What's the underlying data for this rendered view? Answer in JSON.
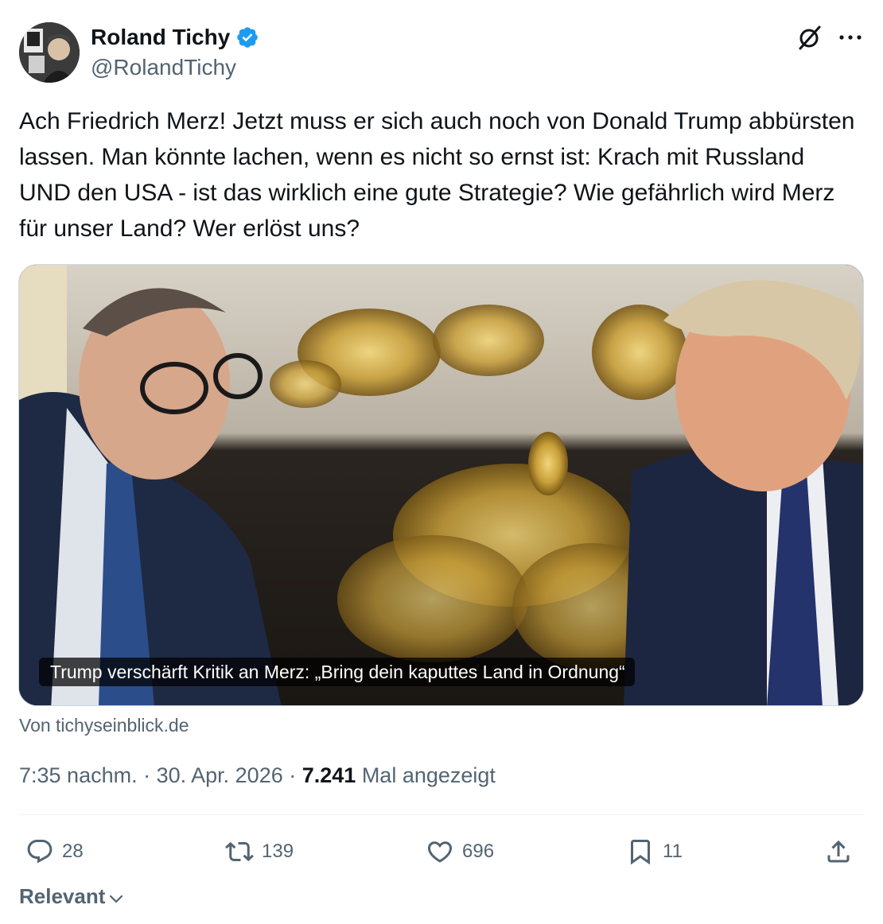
{
  "author": {
    "display_name": "Roland Tichy",
    "handle": "@RolandTichy",
    "verified": true,
    "verified_color": "#1d9bf0"
  },
  "header_icons": [
    "grok-icon",
    "more-options-icon"
  ],
  "tweet": {
    "text": "Ach Friedrich Merz! Jetzt muss er sich auch noch von Donald Trump abbürsten lassen. Man könnte lachen, wenn es nicht so ernst ist: Krach mit Russland UND den USA - ist das wirklich eine gute Strategie? Wie gefährlich wird Merz für unser Land? Wer erlöst uns?"
  },
  "card": {
    "caption": "Trump verschärft Kritik an Merz: „Bring dein kaputtes Land in Ordnung“",
    "source": "Von tichyseinblick.de"
  },
  "meta": {
    "time": "7:35 nachm.",
    "separator": " · ",
    "date": "30. Apr. 2026",
    "views_count": "7.241",
    "views_label": " Mal angezeigt"
  },
  "actions": {
    "reply_count": "28",
    "retweet_count": "139",
    "like_count": "696",
    "bookmark_count": "11"
  },
  "sort": {
    "label": "Relevant"
  },
  "colors": {
    "text_primary": "#0f1419",
    "text_secondary": "#536471",
    "divider": "#eff3f4"
  }
}
